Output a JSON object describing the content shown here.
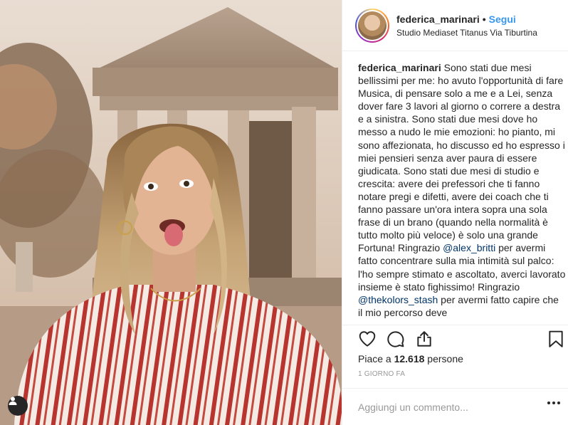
{
  "post": {
    "username": "federica_marinari",
    "separator": "•",
    "follow_label": "Segui",
    "location": "Studio Mediaset Titanus Via Tiburtina"
  },
  "caption": {
    "username": "federica_marinari",
    "text_1": " Sono stati due mesi bellissimi per me: ho avuto l'opportunità di fare Musica, di pensare solo a me e a Lei, senza dover fare 3 lavori al giorno o correre a destra e a sinistra. Sono stati due mesi dove ho messo a nudo le mie emozioni: ho pianto, mi sono affezionata, ho discusso ed ho espresso i miei pensieri senza aver paura di essere giudicata. Sono stati due mesi di studio e crescita: avere dei prefessori che ti fanno notare pregi e difetti, avere dei coach che ti fanno passare un'ora intera sopra una sola frase di un brano (quando nella normalità è tutto molto più veloce) è solo una grande Fortuna! Ringrazio ",
    "mention_1": "@alex_britti",
    "text_2": " per avermi fatto concentrare sulla mia intimità sul palco: l'ho sempre stimato e ascoltato, averci lavorato insieme è stato fighissimo! Ringrazio ",
    "mention_2": "@thekolors_stash",
    "text_3": " per avermi fatto capire che il mio percorso deve"
  },
  "actions": {
    "like_icon": "heart-icon",
    "comment_icon": "comment-icon",
    "share_icon": "share-icon",
    "save_icon": "bookmark-icon"
  },
  "likes": {
    "prefix": "Piace a ",
    "count": "12.618",
    "suffix": " persone"
  },
  "timestamp": "1 GIORNO FA",
  "comment": {
    "placeholder": "Aggiungi un commento..."
  },
  "colors": {
    "link": "#3897f0",
    "mention": "#003569",
    "border": "#efefef"
  }
}
